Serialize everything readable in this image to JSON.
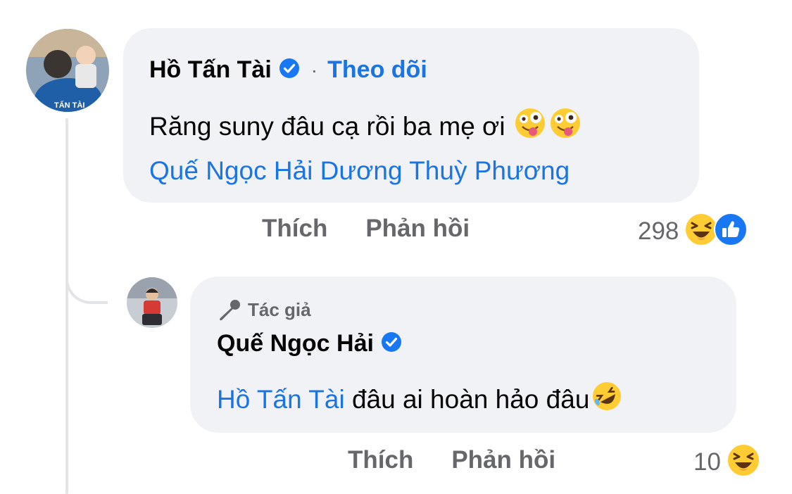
{
  "comment": {
    "author": "Hồ Tấn Tài",
    "separator": "·",
    "follow_label": "Theo dõi",
    "text": "Răng suny đâu cạ rồi ba mẹ ơi",
    "mentions": "Quế Ngọc Hải Dương Thuỳ Phương",
    "like_label": "Thích",
    "reply_label": "Phản hồi",
    "reaction_count": "298",
    "reactions": [
      "haha-icon",
      "like-icon"
    ],
    "inline_emojis": [
      "zany-face-icon",
      "zany-face-icon"
    ]
  },
  "reply": {
    "badge_label": "Tác giả",
    "author": "Quế Ngọc Hải",
    "mention": "Hồ Tấn Tài",
    "text": " đâu ai hoàn hảo đâu",
    "inline_emojis": [
      "rofl-icon"
    ],
    "like_label": "Thích",
    "reply_label": "Phản hồi",
    "reaction_count": "10",
    "reactions": [
      "haha-icon"
    ]
  },
  "colors": {
    "bubble": "#f0f2f5",
    "link": "#1b74e4",
    "muted": "#65676b",
    "verified": "#1877f2",
    "thread_line": "#e2e4e8"
  }
}
